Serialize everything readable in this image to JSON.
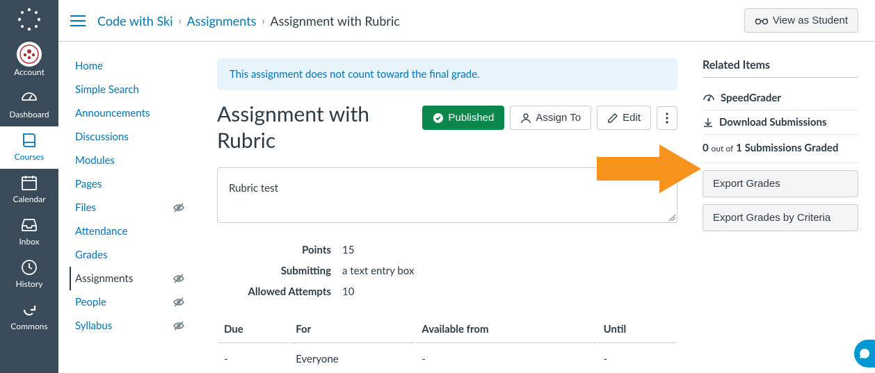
{
  "global_nav": {
    "items": [
      {
        "id": "account",
        "label": "Account"
      },
      {
        "id": "dashboard",
        "label": "Dashboard"
      },
      {
        "id": "courses",
        "label": "Courses"
      },
      {
        "id": "calendar",
        "label": "Calendar"
      },
      {
        "id": "inbox",
        "label": "Inbox"
      },
      {
        "id": "history",
        "label": "History"
      },
      {
        "id": "commons",
        "label": "Commons"
      }
    ]
  },
  "breadcrumb": {
    "course": "Code with Ski",
    "section": "Assignments",
    "current": "Assignment with Rubric"
  },
  "view_as_label": "View as Student",
  "course_nav": {
    "items": [
      {
        "label": "Home",
        "hidden": false
      },
      {
        "label": "Simple Search",
        "hidden": false
      },
      {
        "label": "Announcements",
        "hidden": false
      },
      {
        "label": "Discussions",
        "hidden": false
      },
      {
        "label": "Modules",
        "hidden": false
      },
      {
        "label": "Pages",
        "hidden": false
      },
      {
        "label": "Files",
        "hidden": true
      },
      {
        "label": "Attendance",
        "hidden": false
      },
      {
        "label": "Grades",
        "hidden": false
      },
      {
        "label": "Assignments",
        "hidden": true,
        "active": true
      },
      {
        "label": "People",
        "hidden": true
      },
      {
        "label": "Syllabus",
        "hidden": true
      }
    ]
  },
  "notice": "This assignment does not count toward the final grade.",
  "assignment": {
    "title": "Assignment with Rubric",
    "published_label": "Published",
    "assign_to_label": "Assign To",
    "edit_label": "Edit",
    "description": "Rubric test",
    "meta": {
      "points_label": "Points",
      "points_value": "15",
      "submitting_label": "Submitting",
      "submitting_value": "a text entry box",
      "attempts_label": "Allowed Attempts",
      "attempts_value": "10"
    },
    "due_table": {
      "headers": [
        "Due",
        "For",
        "Available from",
        "Until"
      ],
      "row": [
        "-",
        "Everyone",
        "-",
        "-"
      ]
    }
  },
  "right": {
    "related_title": "Related Items",
    "speedgrader": "SpeedGrader",
    "download": "Download Submissions",
    "graded_count": "0",
    "graded_mid": "out of",
    "graded_total": "1",
    "graded_suffix": "Submissions Graded",
    "export_grades": "Export Grades",
    "export_criteria": "Export Grades by Criteria"
  }
}
